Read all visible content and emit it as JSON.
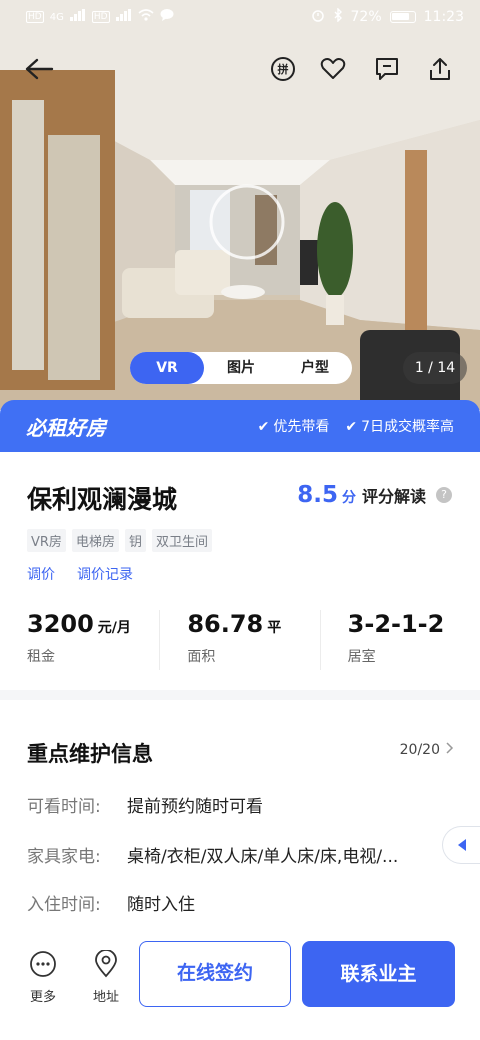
{
  "status_bar": {
    "left_badges": [
      "HD",
      "HD"
    ],
    "network": "4G",
    "battery": "72%",
    "time": "11:23"
  },
  "top_bar": {
    "icons": [
      "back-arrow-icon",
      "pinyin-icon",
      "heart-icon",
      "message-icon",
      "share-icon"
    ],
    "pin_glyph": "拼"
  },
  "media": {
    "tabs": [
      "VR",
      "图片",
      "户型"
    ],
    "active_tab": "VR",
    "counter": "1 / 14"
  },
  "banner": {
    "title": "必租好房",
    "tags": [
      "优先带看",
      "7日成交概率高"
    ]
  },
  "listing": {
    "name": "保利观澜漫城",
    "score": "8.5",
    "score_unit": "分",
    "score_label": "评分解读",
    "tags": [
      "VR房",
      "电梯房",
      "钥",
      "双卫生间"
    ],
    "links": [
      "调价",
      "调价记录"
    ],
    "stats": [
      {
        "value": "3200",
        "unit": "元/月",
        "label": "租金"
      },
      {
        "value": "86.78",
        "unit": "平",
        "label": "面积"
      },
      {
        "value": "3-2-1-2",
        "unit": "",
        "label": "居室"
      }
    ]
  },
  "maintenance": {
    "title": "重点维护信息",
    "count": "20/20",
    "rows": [
      {
        "key": "可看时间:",
        "value": "提前预约随时可看"
      },
      {
        "key": "家具家电:",
        "value": "桌椅/衣柜/双人床/单人床/床,电视/..."
      },
      {
        "key": "入住时间:",
        "value": "随时入住"
      }
    ]
  },
  "bottom_bar": {
    "more_label": "更多",
    "address_label": "地址",
    "sign_label": "在线签约",
    "contact_label": "联系业主"
  },
  "colors": {
    "accent": "#3d65f2",
    "banner": "#4070f4"
  }
}
